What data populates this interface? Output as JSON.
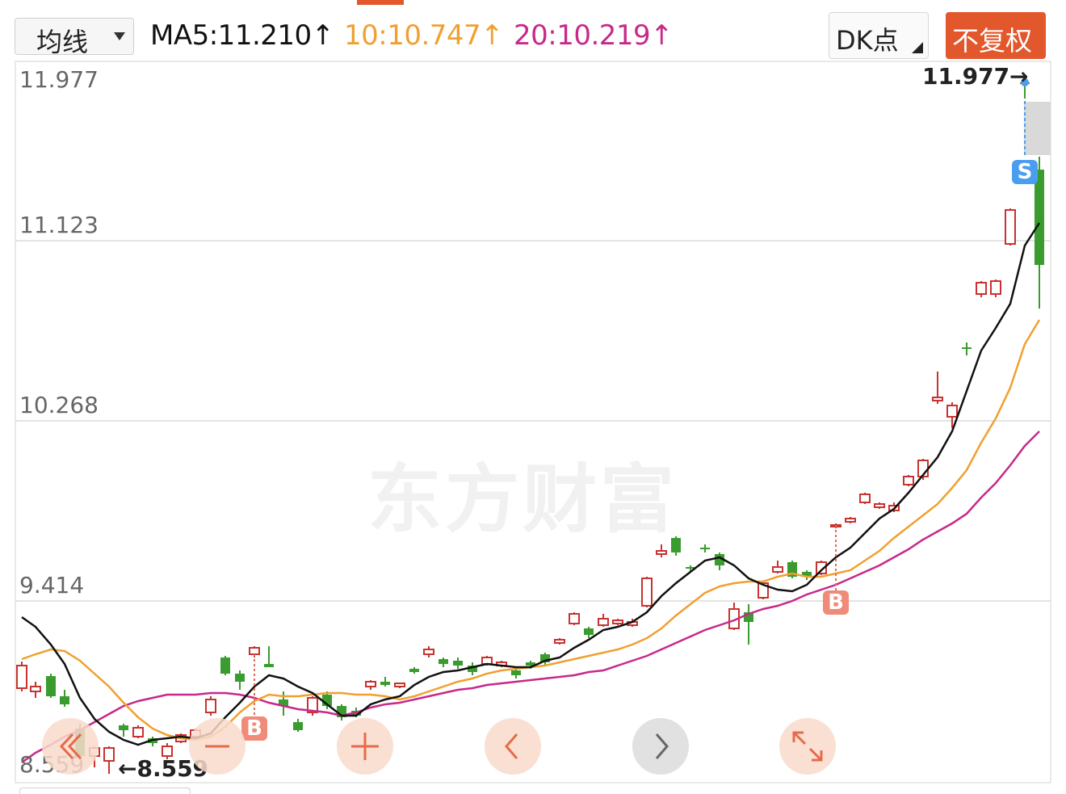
{
  "toolbar": {
    "indicator_select": "均线",
    "ma5": "MA5:11.210↑",
    "ma10": "10:10.747↑",
    "ma20": "20:10.219↑",
    "dk_button": "DK点",
    "adjust_button": "不复权"
  },
  "chart": {
    "y_labels": [
      "11.977",
      "11.123",
      "10.268",
      "9.414",
      "8.559"
    ],
    "max_label": "11.977→",
    "min_label": "←8.559",
    "watermark": "东方财富",
    "signal_b": "B",
    "signal_s": "S"
  },
  "colors": {
    "up": "#c8332f",
    "down": "#3a9c2f",
    "ma5": "#111111",
    "ma10": "#f0a030",
    "ma20": "#c8288a",
    "accent": "#e2572b"
  },
  "nav": [
    "rewind-icon",
    "minus-icon",
    "plus-icon",
    "chevron-left-icon",
    "chevron-right-icon",
    "expand-icon"
  ]
}
